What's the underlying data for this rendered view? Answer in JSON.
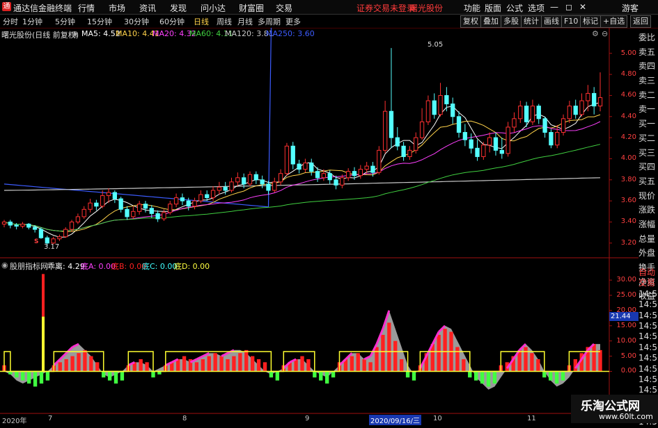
{
  "menubar": {
    "app_title": "通达信金融终端",
    "items": [
      "行情",
      "市场",
      "资讯",
      "发现",
      "问小达",
      "财富圈",
      "交易"
    ],
    "warning": "证券交易未登录",
    "stock_name": "曙光股份",
    "right_items": [
      "功能",
      "版面",
      "公式",
      "选项"
    ],
    "guest": "游客"
  },
  "periodbar": {
    "tabs": [
      "分时",
      "1分钟",
      "5分钟",
      "15分钟",
      "30分钟",
      "60分钟",
      "日线",
      "周线",
      "月线",
      "多周期",
      "更多"
    ],
    "active": "日线",
    "tools": [
      "复权",
      "叠加",
      "多股",
      "统计",
      "画线",
      "F10",
      "标记",
      "+自选",
      "返回"
    ]
  },
  "main_header": {
    "title": "曙光股份(日线 前复权)",
    "ma": [
      {
        "label": "MA5: 4.52",
        "color": "#ffffff"
      },
      {
        "label": "MA10: 4.41",
        "color": "#ffd24a"
      },
      {
        "label": "MA20: 4.32",
        "color": "#ff40ff"
      },
      {
        "label": "MA60: 4.11",
        "color": "#40d040"
      },
      {
        "label": "MA120: 3.81",
        "color": "#c8c8c8"
      },
      {
        "label": "MA250: 3.60",
        "color": "#3c5cff"
      }
    ]
  },
  "sub_header": {
    "title": "股朋指标网",
    "items": [
      {
        "label": "乖离: 4.29",
        "color": "#ffffff"
      },
      {
        "label": "底A: 0.00",
        "color": "#ff40ff"
      },
      {
        "label": "底B: 0.00",
        "color": "#ff2020"
      },
      {
        "label": "底C: 0.00",
        "color": "#40ffff"
      },
      {
        "label": "底D: 0.00",
        "color": "#ffff40"
      }
    ]
  },
  "price_axis": [
    "5.00",
    "4.80",
    "4.60",
    "4.40",
    "4.20",
    "4.00",
    "3.80",
    "3.60",
    "3.40",
    "3.20"
  ],
  "ind_axis": [
    "30.00",
    "25.00",
    "20.00",
    "15.00",
    "10.00",
    "5.00",
    "0.00"
  ],
  "ind_value_badge": "21.44",
  "annotations": {
    "high": "5.05",
    "low": "3.17",
    "signal_mark": "S"
  },
  "right_panel_main": [
    "委比",
    "卖五",
    "卖四",
    "卖三",
    "卖二",
    "卖一",
    "买一",
    "买二",
    "买三",
    "买四",
    "买五",
    "现价",
    "涨跌",
    "涨幅",
    "总量",
    "外盘",
    "换手",
    "净资",
    "收益"
  ],
  "right_panel_sub": [
    "自动",
    "交易",
    "14:56",
    "14:56",
    "14:56",
    "14:56",
    "14:56",
    "14:56",
    "14:56",
    "14:56",
    "14:56",
    "14:56",
    "14:56",
    "14:56",
    "14:56"
  ],
  "date_axis": [
    "2020年",
    "7",
    "8",
    "9",
    "2020/09/16/三",
    "10",
    "11"
  ],
  "watermark": {
    "title": "乐淘公式网",
    "url": "www.60lt.com"
  },
  "chart_data": {
    "type": "candlestick",
    "ylim": [
      3.1,
      5.15
    ],
    "sub_ylim": [
      -4,
      33
    ],
    "candles": [
      [
        3.38,
        3.4,
        3.35,
        3.42
      ],
      [
        3.4,
        3.37,
        3.34,
        3.42
      ],
      [
        3.37,
        3.36,
        3.33,
        3.39
      ],
      [
        3.36,
        3.38,
        3.34,
        3.4
      ],
      [
        3.38,
        3.35,
        3.33,
        3.39
      ],
      [
        3.35,
        3.33,
        3.3,
        3.37
      ],
      [
        3.33,
        3.25,
        3.24,
        3.35
      ],
      [
        3.25,
        3.2,
        3.17,
        3.27
      ],
      [
        3.2,
        3.24,
        3.19,
        3.26
      ],
      [
        3.24,
        3.26,
        3.22,
        3.28
      ],
      [
        3.26,
        3.33,
        3.25,
        3.35
      ],
      [
        3.33,
        3.4,
        3.31,
        3.42
      ],
      [
        3.4,
        3.45,
        3.38,
        3.48
      ],
      [
        3.45,
        3.52,
        3.43,
        3.55
      ],
      [
        3.52,
        3.58,
        3.49,
        3.62
      ],
      [
        3.58,
        3.55,
        3.51,
        3.61
      ],
      [
        3.55,
        3.65,
        3.53,
        3.7
      ],
      [
        3.65,
        3.68,
        3.58,
        3.72
      ],
      [
        3.68,
        3.62,
        3.58,
        3.7
      ],
      [
        3.62,
        3.52,
        3.49,
        3.64
      ],
      [
        3.52,
        3.45,
        3.42,
        3.55
      ],
      [
        3.45,
        3.5,
        3.43,
        3.55
      ],
      [
        3.5,
        3.57,
        3.47,
        3.6
      ],
      [
        3.57,
        3.53,
        3.49,
        3.6
      ],
      [
        3.53,
        3.48,
        3.44,
        3.56
      ],
      [
        3.48,
        3.43,
        3.4,
        3.51
      ],
      [
        3.43,
        3.49,
        3.41,
        3.52
      ],
      [
        3.49,
        3.57,
        3.47,
        3.6
      ],
      [
        3.57,
        3.63,
        3.54,
        3.67
      ],
      [
        3.63,
        3.6,
        3.56,
        3.67
      ],
      [
        3.6,
        3.55,
        3.51,
        3.63
      ],
      [
        3.55,
        3.6,
        3.52,
        3.63
      ],
      [
        3.6,
        3.66,
        3.58,
        3.7
      ],
      [
        3.66,
        3.63,
        3.6,
        3.7
      ],
      [
        3.63,
        3.7,
        3.6,
        3.74
      ],
      [
        3.7,
        3.73,
        3.66,
        3.78
      ],
      [
        3.73,
        3.7,
        3.66,
        3.78
      ],
      [
        3.7,
        3.78,
        3.68,
        3.82
      ],
      [
        3.78,
        3.82,
        3.74,
        3.87
      ],
      [
        3.82,
        3.76,
        3.72,
        3.86
      ],
      [
        3.76,
        3.85,
        3.74,
        3.88
      ],
      [
        3.85,
        3.8,
        3.76,
        3.88
      ],
      [
        3.8,
        3.76,
        3.72,
        3.84
      ],
      [
        3.76,
        3.7,
        3.66,
        3.79
      ],
      [
        3.7,
        3.78,
        3.68,
        3.82
      ],
      [
        3.78,
        3.86,
        3.75,
        3.9
      ],
      [
        3.86,
        4.12,
        3.84,
        4.15
      ],
      [
        4.12,
        3.95,
        3.9,
        4.16
      ],
      [
        3.95,
        3.9,
        3.86,
        3.99
      ],
      [
        3.9,
        3.96,
        3.87,
        4.0
      ],
      [
        3.96,
        3.88,
        3.84,
        4.0
      ],
      [
        3.88,
        3.82,
        3.78,
        3.92
      ],
      [
        3.82,
        3.86,
        3.79,
        3.9
      ],
      [
        3.86,
        3.8,
        3.76,
        3.89
      ],
      [
        3.8,
        3.75,
        3.71,
        3.84
      ],
      [
        3.75,
        3.82,
        3.72,
        3.85
      ],
      [
        3.82,
        3.88,
        3.79,
        3.91
      ],
      [
        3.88,
        3.84,
        3.8,
        3.92
      ],
      [
        3.84,
        3.9,
        3.81,
        3.94
      ],
      [
        3.9,
        3.93,
        3.86,
        3.97
      ],
      [
        3.93,
        3.87,
        3.83,
        3.97
      ],
      [
        3.87,
        4.08,
        3.85,
        4.12
      ],
      [
        4.08,
        4.45,
        4.05,
        4.55
      ],
      [
        4.45,
        4.2,
        4.1,
        5.05
      ],
      [
        4.2,
        4.12,
        4.08,
        4.3
      ],
      [
        4.12,
        4.02,
        3.98,
        4.16
      ],
      [
        4.02,
        4.08,
        3.99,
        4.12
      ],
      [
        4.08,
        4.2,
        4.05,
        4.25
      ],
      [
        4.2,
        4.35,
        4.18,
        4.48
      ],
      [
        4.35,
        4.55,
        4.32,
        4.6
      ],
      [
        4.55,
        4.42,
        4.38,
        4.62
      ],
      [
        4.42,
        4.6,
        4.4,
        4.72
      ],
      [
        4.6,
        4.52,
        4.45,
        4.68
      ],
      [
        4.52,
        4.4,
        4.33,
        4.58
      ],
      [
        4.4,
        4.25,
        4.2,
        4.45
      ],
      [
        4.25,
        4.18,
        4.12,
        4.33
      ],
      [
        4.18,
        4.1,
        4.05,
        4.24
      ],
      [
        4.1,
        4.02,
        3.98,
        4.18
      ],
      [
        4.02,
        4.13,
        3.99,
        4.16
      ],
      [
        4.13,
        4.2,
        4.06,
        4.25
      ],
      [
        4.2,
        4.08,
        4.03,
        4.25
      ],
      [
        4.08,
        4.05,
        4.0,
        4.2
      ],
      [
        4.05,
        4.3,
        4.02,
        4.35
      ],
      [
        4.3,
        4.38,
        4.25,
        4.44
      ],
      [
        4.38,
        4.5,
        4.34,
        4.55
      ],
      [
        4.5,
        4.35,
        4.3,
        4.54
      ],
      [
        4.35,
        4.5,
        4.32,
        4.56
      ],
      [
        4.5,
        4.38,
        4.33,
        4.52
      ],
      [
        4.38,
        4.25,
        4.2,
        4.4
      ],
      [
        4.25,
        4.13,
        4.1,
        4.28
      ],
      [
        4.13,
        4.25,
        4.1,
        4.32
      ],
      [
        4.25,
        4.38,
        4.22,
        4.42
      ],
      [
        4.38,
        4.5,
        4.34,
        4.55
      ],
      [
        4.5,
        4.42,
        4.38,
        4.56
      ],
      [
        4.42,
        4.55,
        4.4,
        4.62
      ],
      [
        4.55,
        4.62,
        4.45,
        4.7
      ],
      [
        4.62,
        4.5,
        4.42,
        4.68
      ],
      [
        4.5,
        4.58,
        4.45,
        4.82
      ]
    ],
    "ma": {
      "MA120": [
        3.7,
        3.82
      ],
      "MA250": [
        3.76,
        3.6
      ]
    },
    "sub": {
      "bars": [
        2,
        -1,
        -2,
        -3,
        -4,
        -5,
        -4,
        -3,
        2,
        3,
        4,
        5,
        6,
        7,
        5,
        3,
        -2,
        -3,
        -4,
        -3,
        2,
        3,
        4,
        3,
        -2,
        -1,
        2,
        3,
        4,
        5,
        4,
        3,
        4,
        5,
        6,
        5,
        4,
        5,
        6,
        7,
        5,
        4,
        3,
        -2,
        -3,
        2,
        3,
        4,
        5,
        4,
        -2,
        -3,
        -4,
        -2,
        3,
        4,
        5,
        6,
        4,
        3,
        8,
        12,
        16,
        10,
        4,
        -2,
        -3,
        2,
        6,
        9,
        12,
        14,
        13,
        8,
        4,
        -2,
        -3,
        -4,
        -5,
        -4,
        2,
        3,
        5,
        7,
        8,
        6,
        4,
        -2,
        -3,
        -4,
        -3,
        2,
        4,
        6,
        8,
        9,
        7
      ],
      "white_line": [
        0,
        -1,
        -3,
        -4,
        -3,
        -2,
        -1,
        0,
        2,
        4,
        6,
        8,
        9,
        7,
        5,
        2,
        -1,
        -2,
        -1,
        0,
        2,
        3,
        3,
        2,
        0,
        1,
        2,
        3,
        4,
        4,
        3,
        4,
        5,
        6,
        6,
        5,
        6,
        7,
        7,
        6,
        4,
        2,
        0,
        -1,
        0,
        1,
        3,
        4,
        4,
        2,
        0,
        -1,
        -2,
        0,
        2,
        4,
        6,
        6,
        4,
        5,
        9,
        14,
        20,
        14,
        8,
        2,
        -1,
        1,
        5,
        9,
        13,
        15,
        14,
        10,
        6,
        2,
        -2,
        -4,
        -6,
        -5,
        -2,
        1,
        4,
        7,
        9,
        7,
        4,
        0,
        -3,
        -5,
        -4,
        -2,
        1,
        4,
        7,
        9,
        9
      ]
    }
  }
}
